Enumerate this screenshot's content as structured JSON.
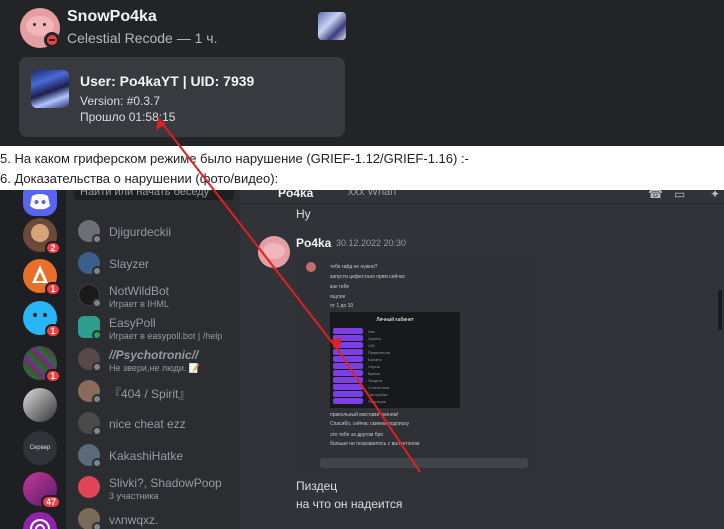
{
  "popup": {
    "username": "SnowPo4ka",
    "activity": "Celestial Recode — 1 ч.",
    "status_color": "#f23f43",
    "card": {
      "line1": "User: Po4kaYT | UID: 7939",
      "line2": "Version: #0.3.7",
      "line3": "Прошло 01:58:15"
    }
  },
  "form": {
    "q5": "5. На каком гриферском режиме было нарушение (GRIEF-1.12/GRIEF-1.16) :-",
    "q6": "6. Доказательства о нарушении (фото/видео):"
  },
  "client": {
    "search_placeholder": "Найти или начать беседу",
    "guilds": [
      {
        "icon": "discord-home-icon",
        "color": "#5865f2"
      },
      {
        "icon": "server-avatar",
        "color": "#6b4a3a",
        "badge": "2"
      },
      {
        "icon": "server-orange",
        "color": "#e8702a",
        "badge": "1"
      },
      {
        "icon": "server-blue-face",
        "color": "#29b6f6",
        "badge": "1"
      },
      {
        "icon": "server-pixel",
        "color": "#4a4e3a",
        "badge": "1"
      },
      {
        "icon": "server-bw",
        "color": "#666666"
      },
      {
        "icon": "server-text",
        "color": "#2b2d31",
        "label": "Сервер"
      },
      {
        "icon": "server-purple",
        "color": "#7b2a8a",
        "badge": "47"
      },
      {
        "icon": "server-radio",
        "color": "#8e24aa"
      }
    ],
    "dms": [
      {
        "name": "Djigurdeckii",
        "sub": "",
        "color": "#6d6f78",
        "status": "offline"
      },
      {
        "name": "Slayzer",
        "sub": "",
        "color": "#3a5f8a",
        "status": "offline"
      },
      {
        "name": "NotWildBot",
        "sub": "Играет в IHML",
        "color": "#1a1a1a",
        "status": "offline"
      },
      {
        "name": "EasyPoll",
        "sub": "Играет в easypoll.bot | /help",
        "color": "#2e9e8e",
        "status": "online"
      },
      {
        "name": "//Psychotronic//",
        "sub": "Не звери,не люди. 📝",
        "color": "#5a4848",
        "status": "offline"
      },
      {
        "name": "『404 / Spirit』",
        "sub": "",
        "color": "#8a6a5a",
        "status": "offline"
      },
      {
        "name": "nice cheat ezz",
        "sub": "",
        "color": "#4a4a4a",
        "status": "offline"
      },
      {
        "name": "KakashiHatke",
        "sub": "",
        "color": "#5a6a7a",
        "status": "offline"
      },
      {
        "name": "Slivki?, ShadowPoop",
        "sub": "3 участника",
        "color": "#e04458",
        "status": "group"
      },
      {
        "name": "vʌnwqxz.",
        "sub": "",
        "color": "#7a6a5a",
        "status": "offline"
      }
    ],
    "chat": {
      "title": "Po4ka",
      "header_extra": "xxx   Whan",
      "prev_message": "Ну",
      "author": "Po4ka",
      "time": "30.12.2022 20:30",
      "reply1": "Пиздец",
      "reply2": "на что он надеится"
    },
    "embed": {
      "lines": [
        "тебе гайд не нужно?",
        "запусти цифестная прям сейчас",
        "как тебе",
        "ящлое",
        "от 1 до 10",
        "прикольный мистами скинем!",
        "Спасибо, сейчас скинем подписку",
        "это тебе за другом бро",
        "больше не понравилось с валентоном"
      ],
      "cabinet_title": "Личный кабинет",
      "rows": [
        "Ник",
        "Группа",
        "UID",
        "Привилегия",
        "Баланс",
        "Серия",
        "Время",
        "Защита",
        "Статистика",
        "Настройки",
        "Подписка",
        "Режим"
      ]
    }
  }
}
